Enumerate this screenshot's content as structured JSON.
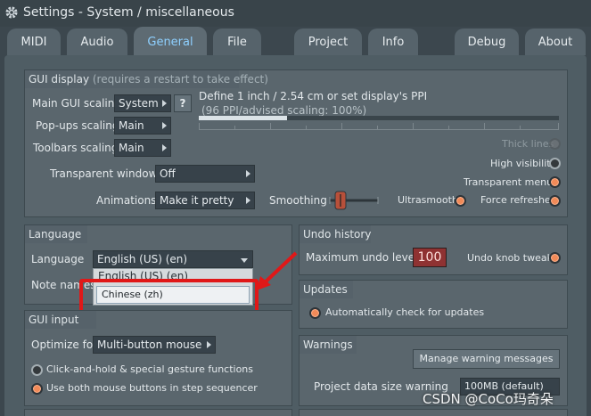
{
  "window": {
    "title": "Settings - System / miscellaneous"
  },
  "tabs": [
    {
      "label": "MIDI"
    },
    {
      "label": "Audio"
    },
    {
      "label": "General"
    },
    {
      "label": "File"
    },
    {
      "label": "Project"
    },
    {
      "label": "Info"
    },
    {
      "label": "Debug"
    },
    {
      "label": "About"
    }
  ],
  "active_tab": "General",
  "gui_display": {
    "title": "GUI display",
    "hint": "(requires a restart to take effect)",
    "main_scaling_label": "Main GUI scaling",
    "main_scaling_value": "System",
    "help_label": "?",
    "popups_label": "Pop-ups scaling",
    "popups_value": "Main",
    "toolbars_label": "Toolbars scaling",
    "toolbars_value": "Main",
    "ppi_title": "Define 1 inch / 2.54 cm or set display's PPI",
    "ppi_status": "(96 PPI/advised scaling: 100%)",
    "ppi_fraction": 0.245,
    "thick_lines": "Thick lines",
    "high_visibility": "High visibility",
    "transparent_menus": "Transparent menus",
    "transparent_windows_label": "Transparent windows",
    "transparent_windows_value": "Off",
    "animations_label": "Animations",
    "animations_value": "Make it pretty",
    "smoothing_label": "Smoothing",
    "ultrasmooth": "Ultrasmooth",
    "force_refreshes": "Force refreshes"
  },
  "language": {
    "title": "Language",
    "language_label": "Language",
    "language_value": "English (US) (en)",
    "note_label": "Note names",
    "options": [
      "English (US) (en)",
      "Chinese (zh)"
    ]
  },
  "undo_history": {
    "title": "Undo history",
    "max_label": "Maximum undo levels",
    "max_value": "100",
    "knob_tweaks": "Undo knob tweaks"
  },
  "updates": {
    "title": "Updates",
    "auto_check": "Automatically check for updates"
  },
  "gui_input": {
    "title": "GUI input",
    "optimize_label": "Optimize for",
    "optimize_value": "Multi-button mouse",
    "click_hold": "Click-and-hold & special gesture functions",
    "both_buttons": "Use both mouse buttons in step sequencer"
  },
  "warnings": {
    "title": "Warnings",
    "manage_button": "Manage warning messages",
    "project_size_label": "Project data size warning",
    "project_size_value": "100MB (default)"
  },
  "watermark": "CSDN @CoCo玛奇朵",
  "colors": {
    "accent": "#f18a58",
    "active_tab_text": "#8ed0ff",
    "annotation": "#e01818"
  }
}
